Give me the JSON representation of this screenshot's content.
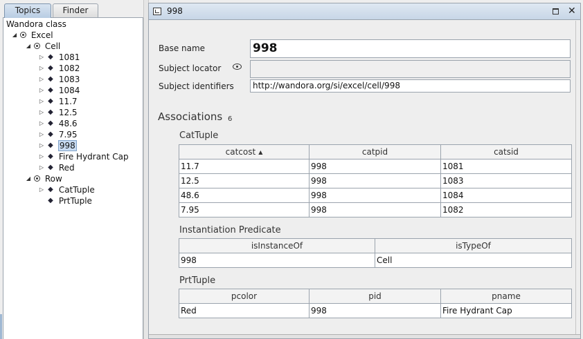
{
  "left_panel": {
    "tabs": [
      {
        "label": "Topics"
      },
      {
        "label": "Finder"
      }
    ],
    "tree": {
      "root": "Wandora class",
      "excel": "Excel",
      "cell": "Cell",
      "cell_items": [
        "1081",
        "1082",
        "1083",
        "1084",
        "11.7",
        "12.5",
        "48.6",
        "7.95",
        "998",
        "Fire Hydrant Cap",
        "Red"
      ],
      "row": "Row",
      "row_items": [
        "CatTuple",
        "PrtTuple"
      ],
      "selected": "998"
    }
  },
  "topic_panel": {
    "title": "998",
    "base_name_label": "Base name",
    "base_name_value": "998",
    "subject_locator_label": "Subject locator",
    "subject_locator_value": "",
    "subject_identifiers_label": "Subject identifiers",
    "subject_identifier_value": "http://wandora.org/si/excel/cell/998",
    "associations_label": "Associations",
    "associations_count": "6",
    "groups": [
      {
        "title": "CatTuple",
        "columns": [
          "catcost",
          "catpid",
          "catsid"
        ],
        "rows": [
          [
            "11.7",
            "998",
            "1081"
          ],
          [
            "12.5",
            "998",
            "1083"
          ],
          [
            "48.6",
            "998",
            "1084"
          ],
          [
            "7.95",
            "998",
            "1082"
          ]
        ]
      },
      {
        "title": "Instantiation Predicate",
        "columns": [
          "isInstanceOf",
          "isTypeOf"
        ],
        "rows": [
          [
            "998",
            "Cell"
          ]
        ]
      },
      {
        "title": "PrtTuple",
        "columns": [
          "pcolor",
          "pid",
          "pname"
        ],
        "rows": [
          [
            "Red",
            "998",
            "Fire Hydrant Cap"
          ]
        ]
      }
    ]
  }
}
